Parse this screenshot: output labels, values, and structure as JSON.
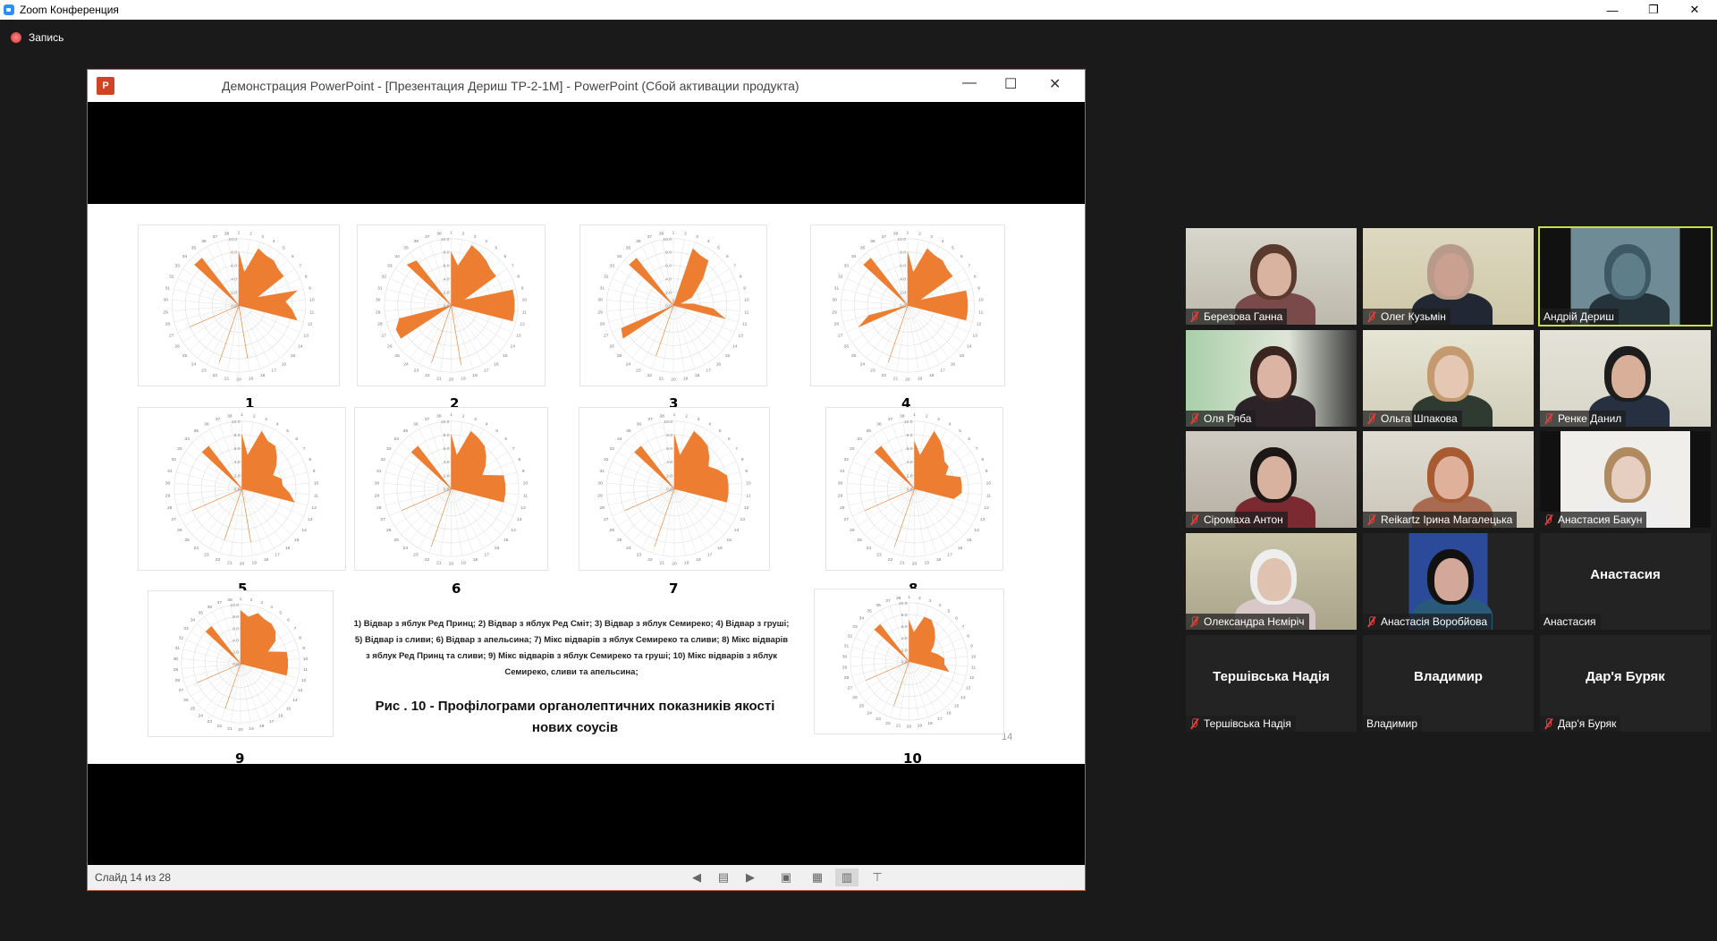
{
  "app": {
    "title": "Zoom Конференция",
    "recording_label": "Запись"
  },
  "ppt": {
    "window_title": "Демонстрация PowerPoint - [Презентация Дериш ТР-2-1М] - PowerPoint (Сбой активации продукта)",
    "status_text": "Слайд 14 из 28",
    "slide": {
      "legend": "1) Відвар з яблук Ред Принц; 2) Відвар з яблук Ред Сміт; 3) Відвар з яблук Семиреко; 4) Відвар з груші; 5) Відвар із сливи; 6) Відвар з апельсина;  7) Мікс відварів з яблук Семиреко та сливи;  8) Мікс відварів з яблук Ред Принц та сливи; 9) Мікс відварів з яблук Семиреко та груші; 10) Мікс відварів з яблук Семиреко, сливи та апельсина;",
      "figure_title": "Рис . 10 - Профілограми органолептичних показників якості нових соусів",
      "page_number": "14"
    }
  },
  "chart_data": {
    "type": "radar",
    "color": "#ed7d31",
    "rlim": [
      0,
      10
    ],
    "ticks": [
      "0.0",
      "2.0",
      "4.0",
      "6.0",
      "8.0",
      "10.0"
    ],
    "categories": [
      "1",
      "2",
      "3",
      "4",
      "5",
      "6",
      "7",
      "8",
      "9",
      "10",
      "11",
      "12",
      "13",
      "14",
      "15",
      "16",
      "17",
      "18",
      "19",
      "20",
      "21",
      "22",
      "23",
      "24",
      "25",
      "26",
      "27",
      "28",
      "29",
      "30",
      "31",
      "32",
      "33",
      "34",
      "35",
      "36",
      "37",
      "38"
    ],
    "charts": [
      {
        "label": "1",
        "values": [
          8,
          5,
          9,
          8.5,
          8.5,
          8,
          8,
          3,
          9,
          7,
          8,
          9,
          0,
          0,
          0,
          0,
          0,
          0,
          8,
          0,
          0,
          9,
          0,
          0,
          0,
          0,
          8,
          0,
          0,
          0,
          0,
          0,
          0,
          9,
          9,
          0,
          0,
          0
        ]
      },
      {
        "label": "2",
        "values": [
          8,
          6,
          9.5,
          9,
          8.5,
          8,
          8,
          2,
          9.5,
          9.5,
          9.5,
          9.5,
          0,
          0,
          0,
          0,
          0,
          0,
          9,
          0,
          0,
          9,
          0,
          0,
          0,
          9,
          9,
          8,
          0,
          0,
          0,
          0,
          0,
          9,
          8.5,
          0,
          0,
          0
        ]
      },
      {
        "label": "3",
        "values": [
          1,
          0,
          9,
          8.5,
          8.5,
          6,
          4,
          3,
          1,
          3,
          6,
          8,
          0,
          0,
          0,
          0,
          0,
          0,
          0,
          0,
          0,
          8,
          0,
          0,
          0,
          9,
          8.5,
          0,
          0,
          0,
          0,
          0,
          0,
          9,
          9,
          0,
          0,
          0
        ]
      },
      {
        "label": "4",
        "values": [
          8,
          5,
          9,
          8.5,
          8.5,
          8,
          8,
          2,
          9,
          9,
          9,
          9,
          0,
          0,
          0,
          0,
          0,
          0,
          0,
          0,
          0,
          9,
          0,
          0,
          0,
          0,
          8,
          6,
          0,
          0,
          0,
          0,
          0,
          9,
          9,
          0,
          0,
          0
        ]
      },
      {
        "label": "5",
        "values": [
          8,
          5,
          9,
          8,
          8,
          7,
          6,
          5,
          6,
          6,
          7,
          8,
          0,
          0,
          0,
          0,
          0,
          0,
          8,
          0,
          0,
          8,
          0,
          0,
          0,
          0,
          8,
          0,
          0,
          0,
          0,
          0,
          0,
          8,
          8,
          0,
          0,
          0
        ]
      },
      {
        "label": "6",
        "values": [
          8,
          5,
          9,
          8.5,
          8,
          7,
          6,
          5,
          8,
          8,
          8,
          8,
          0,
          0,
          0,
          0,
          0,
          0,
          0,
          0,
          0,
          9,
          0,
          0,
          0,
          0,
          8,
          0,
          0,
          0,
          0,
          0,
          0,
          8,
          8,
          0,
          0,
          0
        ]
      },
      {
        "label": "7",
        "values": [
          8,
          5,
          9,
          8.5,
          8,
          7,
          6,
          7,
          8,
          8,
          8,
          8,
          0,
          0,
          0,
          0,
          0,
          0,
          0,
          0,
          0,
          9,
          0,
          0,
          0,
          0,
          8,
          0,
          0,
          0,
          0,
          0,
          0,
          8,
          8,
          0,
          0,
          0
        ]
      },
      {
        "label": "8",
        "values": [
          7,
          5,
          9,
          8,
          7,
          6,
          6,
          5,
          7,
          7,
          7,
          6,
          0,
          0,
          0,
          0,
          0,
          0,
          0,
          0,
          0,
          9,
          0,
          0,
          0,
          0,
          8,
          0,
          0,
          0,
          0,
          0,
          0,
          8,
          8,
          0,
          0,
          0
        ]
      },
      {
        "label": "9",
        "values": [
          9,
          8,
          9,
          8.5,
          8.5,
          8,
          7,
          5,
          8,
          8,
          8,
          8,
          0,
          0,
          0,
          0,
          0,
          0,
          0,
          0,
          0,
          8,
          0,
          0,
          0,
          0,
          8,
          0,
          0,
          0,
          0,
          0,
          0,
          8,
          8,
          0,
          0,
          0
        ]
      },
      {
        "label": "10",
        "values": [
          7,
          5,
          8,
          8,
          7,
          6,
          5,
          4,
          5,
          6,
          6,
          7,
          0,
          0,
          0,
          0,
          0,
          0,
          0,
          0,
          0,
          8,
          0,
          0,
          0,
          0,
          8,
          0,
          0,
          0,
          0,
          0,
          0,
          8,
          8,
          0,
          0,
          0
        ]
      }
    ]
  },
  "participants": [
    {
      "name": "Березова Ганна",
      "muted": true,
      "video": true
    },
    {
      "name": "Олег Кузьмін",
      "muted": true,
      "video": true
    },
    {
      "name": "Андрій Дериш",
      "muted": false,
      "video": true,
      "active": true
    },
    {
      "name": "Оля Ряба",
      "muted": true,
      "video": true
    },
    {
      "name": "Ольга Шпакова",
      "muted": true,
      "video": true
    },
    {
      "name": "Ренке Данил",
      "muted": true,
      "video": true
    },
    {
      "name": "Сіромаха Антон",
      "muted": true,
      "video": true
    },
    {
      "name": "Reikartz Ірина Магалецька",
      "muted": true,
      "video": true
    },
    {
      "name": "Анастасия Бакун",
      "muted": true,
      "video": true
    },
    {
      "name": "Олександра Нєміріч",
      "muted": true,
      "video": true
    },
    {
      "name": "Анастасія Воробйова",
      "muted": true,
      "video": true
    },
    {
      "name": "Анастасия",
      "display": "Анастасия",
      "muted": false,
      "video": false
    },
    {
      "name": "Тершівська Надія",
      "display": "Тершівська  Надія",
      "muted": true,
      "video": false
    },
    {
      "name": "Владимир",
      "display": "Владимир",
      "muted": false,
      "video": false
    },
    {
      "name": "Дар'я Буряк",
      "display": "Дар'я Буряк",
      "muted": true,
      "video": false
    }
  ]
}
